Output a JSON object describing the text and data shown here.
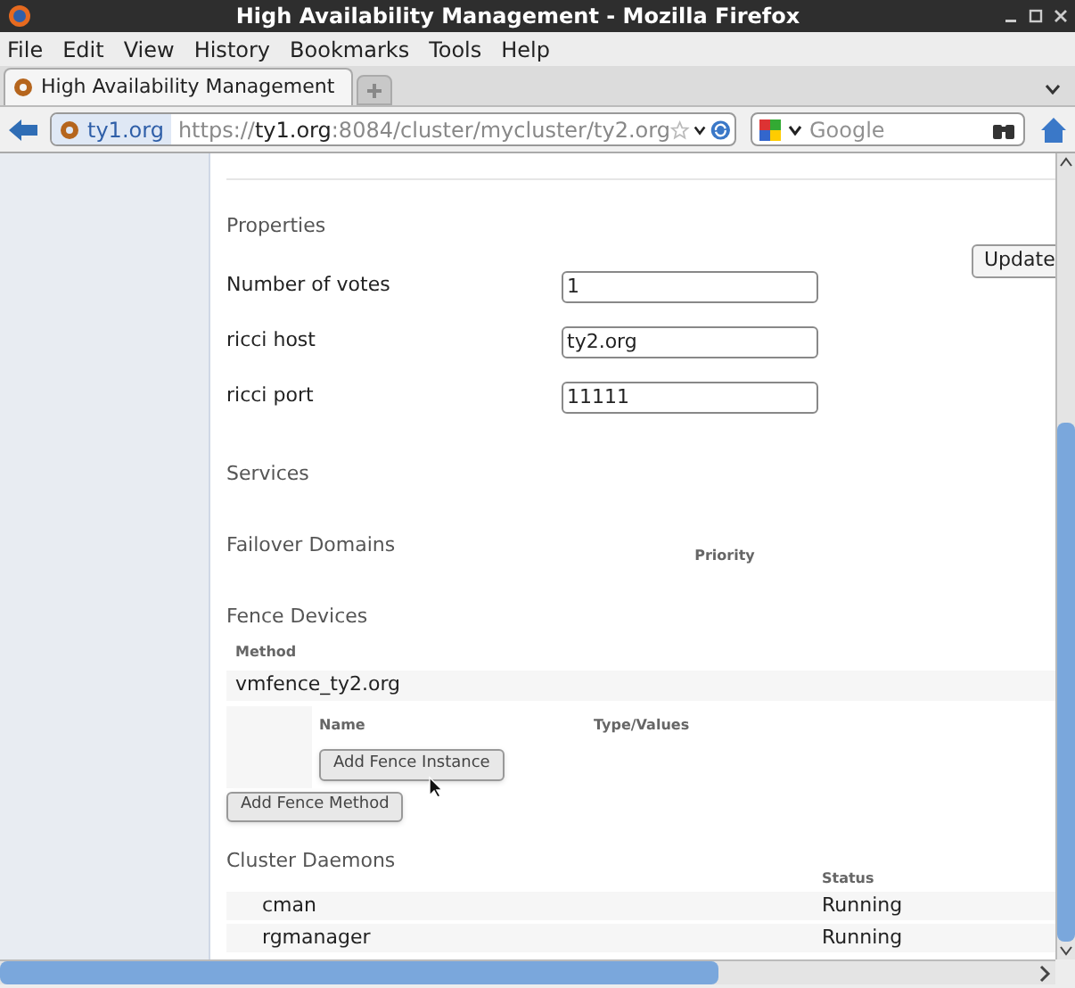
{
  "window": {
    "title": "High Availability Management - Mozilla Firefox"
  },
  "menu": [
    "File",
    "Edit",
    "View",
    "History",
    "Bookmarks",
    "Tools",
    "Help"
  ],
  "tabs": [
    {
      "label": "High Availability Management",
      "selected": true
    }
  ],
  "address": {
    "site": "ty1.org",
    "scheme": "https://",
    "host": "ty1.org",
    "path": ":8084/cluster/mycluster/ty2.org"
  },
  "search": {
    "placeholder": "Google"
  },
  "page": {
    "properties": {
      "heading": "Properties",
      "fields": [
        {
          "label": "Number of votes",
          "value": "1"
        },
        {
          "label": "ricci host",
          "value": "ty2.org"
        },
        {
          "label": "ricci port",
          "value": "11111"
        }
      ],
      "button": "Update"
    },
    "services": {
      "heading": "Services"
    },
    "failover": {
      "heading": "Failover Domains",
      "column": "Priority"
    },
    "fence": {
      "heading": "Fence Devices",
      "column": "Method",
      "methods": [
        {
          "name": "vmfence_ty2.org",
          "columns": [
            "Name",
            "Type/Values"
          ],
          "button": "Add Fence Instance"
        }
      ],
      "add_button": "Add Fence Method"
    },
    "daemons": {
      "heading": "Cluster Daemons",
      "status_column": "Status",
      "rows": [
        {
          "name": "cman",
          "status": "Running"
        },
        {
          "name": "rgmanager",
          "status": "Running"
        }
      ]
    }
  }
}
